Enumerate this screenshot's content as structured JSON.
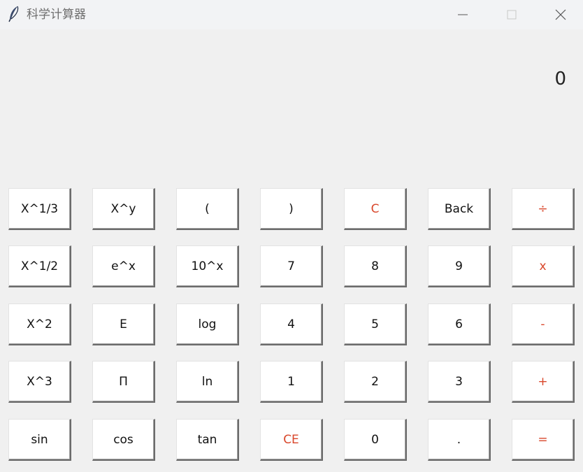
{
  "window": {
    "title": "科学计算器",
    "icon": "feather-icon"
  },
  "display": {
    "value": "0"
  },
  "colors": {
    "operator": "#d9472b",
    "background": "#f0f0f0",
    "key": "#ffffff"
  },
  "keys": [
    [
      "X^1/3",
      "X^y",
      "(",
      ")",
      "C",
      "Back",
      "÷"
    ],
    [
      "X^1/2",
      "e^x",
      "10^x",
      "7",
      "8",
      "9",
      "x"
    ],
    [
      "X^2",
      "E",
      "log",
      "4",
      "5",
      "6",
      "-"
    ],
    [
      "X^3",
      "Π",
      "ln",
      "1",
      "2",
      "3",
      "+"
    ],
    [
      "sin",
      "cos",
      "tan",
      "CE",
      "0",
      ".",
      "="
    ]
  ]
}
